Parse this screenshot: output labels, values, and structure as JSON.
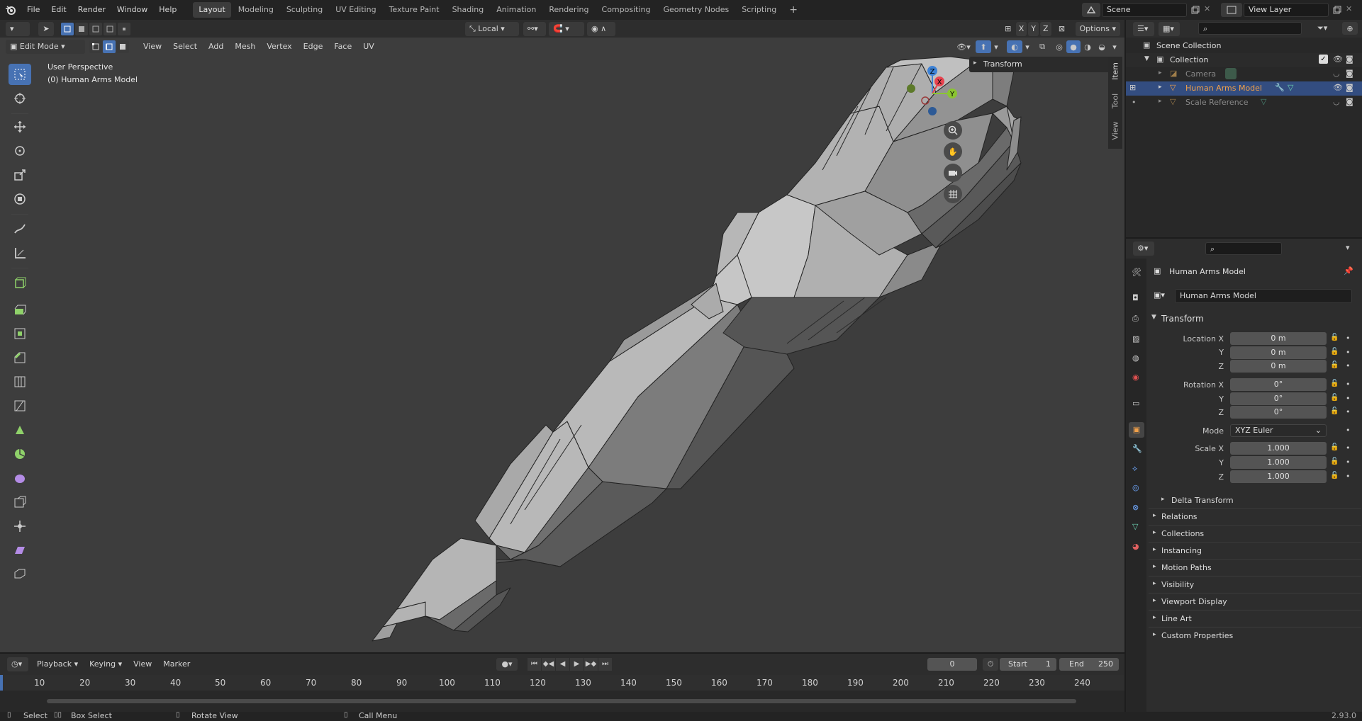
{
  "topbar": {
    "menus": [
      "File",
      "Edit",
      "Render",
      "Window",
      "Help"
    ],
    "workspaces": [
      "Layout",
      "Modeling",
      "Sculpting",
      "UV Editing",
      "Texture Paint",
      "Shading",
      "Animation",
      "Rendering",
      "Compositing",
      "Geometry Nodes",
      "Scripting"
    ],
    "active_workspace": "Layout",
    "scene": "Scene",
    "view_layer": "View Layer"
  },
  "tool_header": {
    "transform_orientation": "Local",
    "axes": [
      "X",
      "Y",
      "Z"
    ],
    "options_label": "Options"
  },
  "viewport_header": {
    "mode": "Edit Mode",
    "menus": [
      "View",
      "Select",
      "Add",
      "Mesh",
      "Vertex",
      "Edge",
      "Face",
      "UV"
    ]
  },
  "viewport": {
    "perspective_label": "User Perspective",
    "object_label": "(0) Human Arms Model",
    "n_panel_title": "Transform",
    "side_tabs": [
      "Item",
      "Tool",
      "View"
    ],
    "gizmo_axes": [
      "Z",
      "X",
      "Y"
    ]
  },
  "outliner": {
    "root": "Scene Collection",
    "collection": "Collection",
    "items": [
      {
        "name": "Camera",
        "selected": false
      },
      {
        "name": "Human Arms Model",
        "selected": true
      },
      {
        "name": "Scale Reference",
        "selected": false
      }
    ]
  },
  "properties": {
    "object_name": "Human Arms Model",
    "data_name": "Human Arms Model",
    "transform_title": "Transform",
    "location_label": "Location X",
    "rotation_label": "Rotation X",
    "scale_label": "Scale X",
    "axis_y": "Y",
    "axis_z": "Z",
    "location": [
      "0 m",
      "0 m",
      "0 m"
    ],
    "rotation": [
      "0°",
      "0°",
      "0°"
    ],
    "mode_label": "Mode",
    "mode_value": "XYZ Euler",
    "scale": [
      "1.000",
      "1.000",
      "1.000"
    ],
    "delta_transform": "Delta Transform",
    "sections": [
      "Relations",
      "Collections",
      "Instancing",
      "Motion Paths",
      "Visibility",
      "Viewport Display",
      "Line Art",
      "Custom Properties"
    ]
  },
  "timeline": {
    "menus": [
      "Playback",
      "Keying",
      "View",
      "Marker"
    ],
    "current_frame": "0",
    "start_label": "Start",
    "start": "1",
    "end_label": "End",
    "end": "250",
    "ticks": [
      "10",
      "20",
      "30",
      "40",
      "50",
      "60",
      "70",
      "80",
      "90",
      "100",
      "110",
      "120",
      "130",
      "140",
      "150",
      "160",
      "170",
      "180",
      "190",
      "200",
      "210",
      "220",
      "230",
      "240"
    ]
  },
  "statusbar": {
    "select": "Select",
    "box_select": "Box Select",
    "rotate_view": "Rotate View",
    "call_menu": "Call Menu",
    "version": "2.93.0"
  },
  "colors": {
    "accent": "#4772b3",
    "viewport_bg": "#3d3d3d",
    "mesh_light": "#b9b9b9",
    "mesh_dark": "#4a4a4a",
    "selected_orange": "#f0a04a",
    "axis_x": "#e8434f",
    "axis_y": "#8ac531",
    "axis_z": "#3d82d6"
  }
}
